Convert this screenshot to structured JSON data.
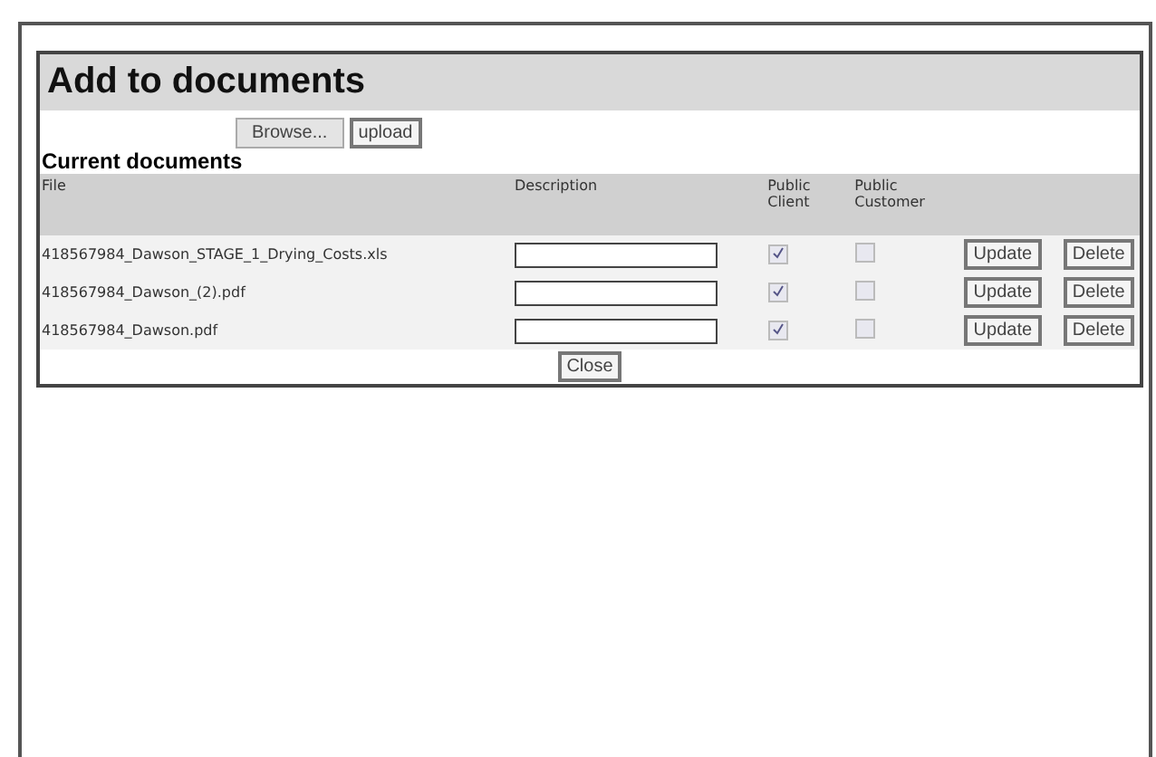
{
  "title": "Add to documents",
  "upload": {
    "browse": "Browse...",
    "upload": "upload"
  },
  "section": "Current documents",
  "columns": [
    "File",
    "Description",
    "Public Client",
    "Public Customer"
  ],
  "rows": [
    {
      "file": "418567984_Dawson_STAGE_1_Drying_Costs.xls",
      "public_client": true,
      "public_customer": false,
      "update": "Update",
      "delete": "Delete"
    },
    {
      "file": "418567984_Dawson_(2).pdf",
      "public_client": true,
      "public_customer": false,
      "update": "Update",
      "delete": "Delete"
    },
    {
      "file": "418567984_Dawson.pdf",
      "public_client": true,
      "public_customer": false,
      "update": "Update",
      "delete": "Delete"
    }
  ],
  "close": "Close"
}
